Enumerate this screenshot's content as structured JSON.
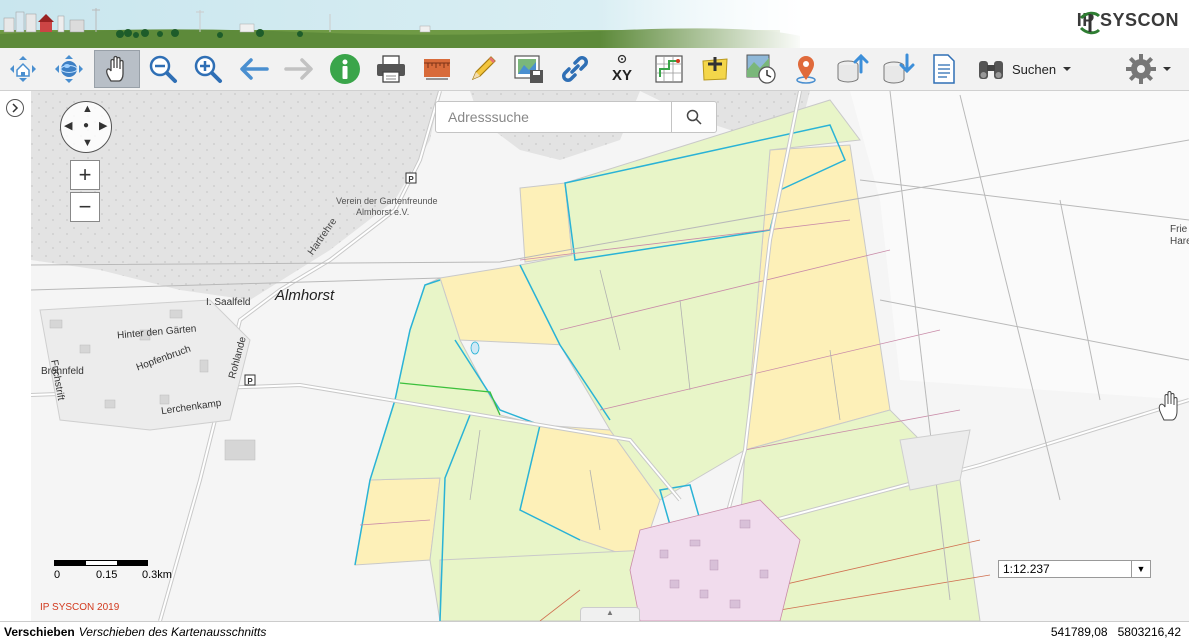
{
  "logo": {
    "text": "IP SYSCON"
  },
  "toolbar": {
    "tools": [
      {
        "name": "home-extent-tool",
        "icon": "home-arrows-icon"
      },
      {
        "name": "globe-extent-tool",
        "icon": "globe-arrows-icon"
      },
      {
        "name": "pan-tool",
        "icon": "hand-icon",
        "active": true
      },
      {
        "name": "zoom-out-tool",
        "icon": "zoom-out-icon"
      },
      {
        "name": "zoom-in-tool",
        "icon": "zoom-in-icon"
      },
      {
        "name": "back-tool",
        "icon": "arrow-left-icon"
      },
      {
        "name": "forward-tool",
        "icon": "arrow-right-icon",
        "disabled": true
      },
      {
        "name": "info-tool",
        "icon": "info-icon"
      },
      {
        "name": "print-tool",
        "icon": "printer-icon"
      },
      {
        "name": "measure-tool",
        "icon": "ruler-icon"
      },
      {
        "name": "draw-tool",
        "icon": "pencil-icon"
      },
      {
        "name": "save-map-tool",
        "icon": "save-map-icon"
      },
      {
        "name": "link-tool",
        "icon": "link-icon"
      },
      {
        "name": "coordinate-tool",
        "icon": "xy-icon",
        "label": "XY"
      },
      {
        "name": "grid-tool",
        "icon": "grid-icon"
      },
      {
        "name": "add-note-tool",
        "icon": "note-add-icon"
      },
      {
        "name": "history-tool",
        "icon": "map-clock-icon"
      },
      {
        "name": "location-tool",
        "icon": "pin-icon"
      },
      {
        "name": "upload-tool",
        "icon": "database-upload-icon"
      },
      {
        "name": "download-tool",
        "icon": "database-download-icon"
      },
      {
        "name": "document-tool",
        "icon": "document-icon"
      }
    ],
    "search_label": "Suchen",
    "search_icon": "binoculars-icon",
    "settings_icon": "gear-icon"
  },
  "address_search": {
    "placeholder": "Adresssuche"
  },
  "zoom": {
    "plus": "+",
    "minus": "−"
  },
  "scalebar": {
    "labels": [
      "0",
      "0.15",
      "0.3km"
    ]
  },
  "copyright": "IP SYSCON 2019",
  "scale_select": {
    "value": "1:12.237"
  },
  "status": {
    "mode": "Verschieben",
    "description": "Verschieben des Kartenausschnitts"
  },
  "coordinates": {
    "x": "541789,08",
    "y": "5803216,42"
  },
  "map_labels": {
    "place": "Almhorst",
    "club_line1": "Verein der Gartenfreunde",
    "club_line2": "Almhorst e.V.",
    "hartrehre": "Hartrehre",
    "saalfeld": "I. Saalfeld",
    "hinter_den_gaerten": "Hinter den Gärten",
    "hopfenbruch": "Hopfenbruch",
    "fuchstrift": "Fuchstrift",
    "brohnfeld": "Brohnfeld",
    "rohlande": "Rohlande",
    "lerchenkamp": "Lerchenkamp",
    "friedhof_short": "Frie",
    "harenberg_short": "Hare",
    "parking": "P"
  },
  "colors": {
    "farmland": "#e8f5c8",
    "farmland_alt": "#fdf0b8",
    "parcel_outline": "#2ab3d6",
    "road": "#c9c9c9",
    "settlement": "#f1dced",
    "forest": "#e0e0e0",
    "active_tool": "#b8bfc7"
  }
}
